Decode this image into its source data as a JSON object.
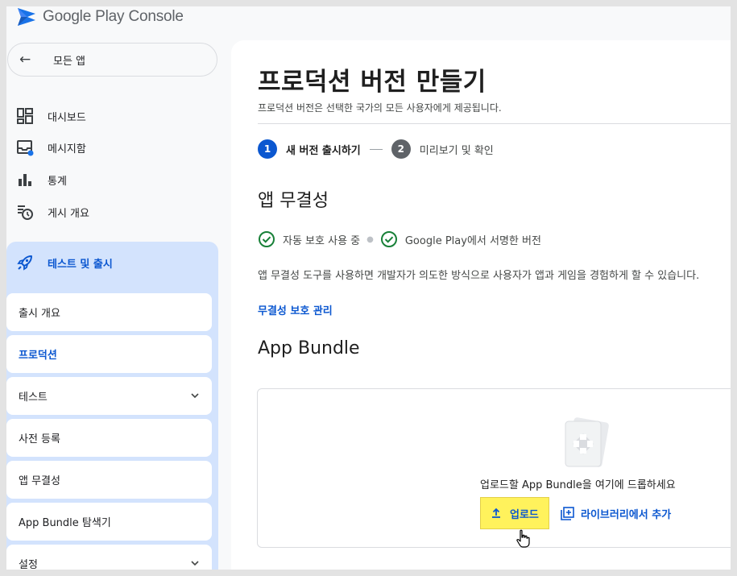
{
  "app": {
    "name_part1": "Google",
    "name_part2": "Play",
    "name_part3": "Console"
  },
  "sidebar": {
    "back_label": "모든 앱",
    "items": [
      {
        "label": "대시보드",
        "icon": "dashboard-icon"
      },
      {
        "label": "메시지함",
        "icon": "inbox-icon"
      },
      {
        "label": "통계",
        "icon": "bar-chart-icon"
      },
      {
        "label": "게시 개요",
        "icon": "publishing-overview-icon"
      }
    ],
    "section": {
      "label": "테스트 및 출시",
      "icon": "rocket-icon",
      "subitems": [
        {
          "label": "출시 개요"
        },
        {
          "label": "프로덕션"
        },
        {
          "label": "테스트"
        },
        {
          "label": "사전 등록"
        },
        {
          "label": "앱 무결성"
        },
        {
          "label": "App Bundle 탐색기"
        },
        {
          "label": "설정"
        }
      ]
    }
  },
  "main": {
    "title": "프로덕션 버전 만들기",
    "subtitle": "프로덕션 버전은 선택한 국가의 모든 사용자에게 제공됩니다.",
    "steps": [
      {
        "num": "1",
        "label": "새 버전 출시하기"
      },
      {
        "num": "2",
        "label": "미리보기 및 확인"
      }
    ],
    "integrity": {
      "heading": "앱 무결성",
      "check1": "자동 보호 사용 중",
      "check2": "Google Play에서 서명한 버전",
      "description": "앱 무결성 도구를 사용하면 개발자가 의도한 방식으로 사용자가 앱과 게임을 경험하게 할 수 있습니다.",
      "link": "무결성 보호 관리"
    },
    "bundle": {
      "heading": "App Bundle",
      "drop_text": "업로드할 App Bundle을 여기에 드롭하세요",
      "upload_label": "업로드",
      "library_label": "라이브러리에서 추가"
    }
  },
  "colors": {
    "accent": "#0b57d0",
    "nav_selected_bg": "#d3e3fd",
    "check": "#188038",
    "highlight": "#fff25c"
  }
}
